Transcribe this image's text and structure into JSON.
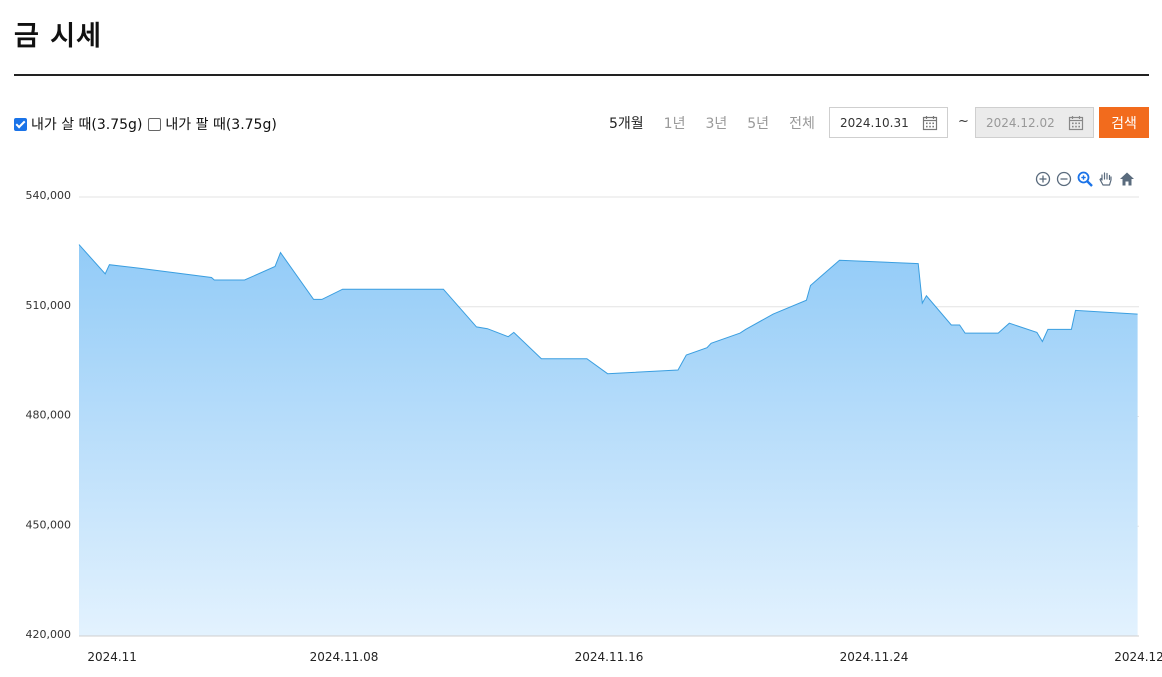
{
  "page": {
    "title": "금 시세"
  },
  "options": {
    "buy": {
      "label": "내가 살 때(3.75g)",
      "checked": true
    },
    "sell": {
      "label": "내가 팔 때(3.75g)",
      "checked": false
    }
  },
  "periods": [
    {
      "label": "5개월",
      "active": true
    },
    {
      "label": "1년",
      "active": false
    },
    {
      "label": "3년",
      "active": false
    },
    {
      "label": "5년",
      "active": false
    },
    {
      "label": "전체",
      "active": false
    }
  ],
  "date_range": {
    "start": "2024.10.31",
    "separator": "~",
    "end": "2024.12.02"
  },
  "search_label": "검색",
  "toolbar_icons": [
    "zoom-in-icon",
    "zoom-out-icon",
    "zoom-select-icon",
    "pan-hand-icon",
    "home-icon"
  ],
  "colors": {
    "accent": "#f26b1d",
    "line": "#3a9ee0",
    "fill_top": "#92cbf7",
    "fill_bottom": "#e3f2fe"
  },
  "chart_data": {
    "type": "area",
    "ylim": [
      420000,
      540000
    ],
    "yticks": [
      420000,
      450000,
      480000,
      510000,
      540000
    ],
    "ytick_labels": [
      "420,000",
      "450,000",
      "480,000",
      "510,000",
      "540,000"
    ],
    "xlim": [
      "2024-10-31",
      "2024-12-02"
    ],
    "xticks": [
      "2024-11-01",
      "2024-11-08",
      "2024-11-16",
      "2024-11-24",
      "2024-12-02"
    ],
    "xtick_labels": [
      "2024.11",
      "2024.11.08",
      "2024.11.16",
      "2024.11.24",
      "2024.12"
    ],
    "grid": true,
    "points": [
      [
        "2024-10-31 00:00",
        527000
      ],
      [
        "2024-10-31 19:00",
        519000
      ],
      [
        "2024-10-31 22:00",
        521500
      ],
      [
        "2024-11-01 20:00",
        520500
      ],
      [
        "2024-11-04 00:00",
        518000
      ],
      [
        "2024-11-04 02:00",
        517300
      ],
      [
        "2024-11-05 00:00",
        517300
      ],
      [
        "2024-11-05 22:00",
        521000
      ],
      [
        "2024-11-06 02:00",
        524800
      ],
      [
        "2024-11-07 02:00",
        512000
      ],
      [
        "2024-11-07 08:00",
        512000
      ],
      [
        "2024-11-07 23:00",
        514800
      ],
      [
        "2024-11-11 00:00",
        514800
      ],
      [
        "2024-11-12 00:00",
        504500
      ],
      [
        "2024-11-12 08:00",
        504000
      ],
      [
        "2024-11-12 23:00",
        501800
      ],
      [
        "2024-11-13 03:00",
        503000
      ],
      [
        "2024-11-13 23:00",
        495800
      ],
      [
        "2024-11-15 08:00",
        495800
      ],
      [
        "2024-11-15 23:00",
        491700
      ],
      [
        "2024-11-18 02:00",
        492700
      ],
      [
        "2024-11-18 08:00",
        496800
      ],
      [
        "2024-11-18 23:00",
        498800
      ],
      [
        "2024-11-19 02:00",
        500000
      ],
      [
        "2024-11-19 23:00",
        502800
      ],
      [
        "2024-11-20 03:00",
        503800
      ],
      [
        "2024-11-20 23:00",
        508000
      ],
      [
        "2024-11-21 23:00",
        511800
      ],
      [
        "2024-11-22 02:00",
        515800
      ],
      [
        "2024-11-22 08:00",
        517800
      ],
      [
        "2024-11-22 23:00",
        522700
      ],
      [
        "2024-11-25 08:00",
        521800
      ],
      [
        "2024-11-25 11:00",
        511000
      ],
      [
        "2024-11-25 14:00",
        513000
      ],
      [
        "2024-11-26 08:00",
        505000
      ],
      [
        "2024-11-26 14:00",
        505000
      ],
      [
        "2024-11-26 18:00",
        502800
      ],
      [
        "2024-11-27 18:00",
        502800
      ],
      [
        "2024-11-28 02:00",
        505500
      ],
      [
        "2024-11-28 22:00",
        503000
      ],
      [
        "2024-11-29 02:00",
        500500
      ],
      [
        "2024-11-29 06:00",
        503800
      ],
      [
        "2024-11-29 23:00",
        503800
      ],
      [
        "2024-11-30 02:00",
        509000
      ],
      [
        "2024-12-01 23:00",
        508000
      ]
    ]
  }
}
